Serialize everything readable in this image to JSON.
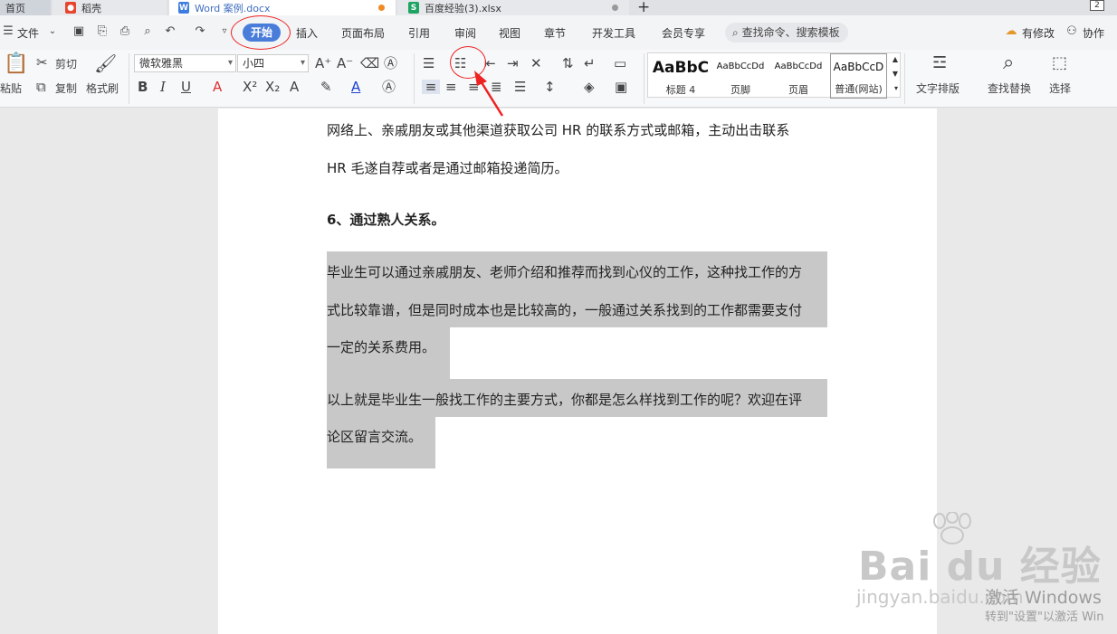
{
  "tabs": {
    "home": "首页",
    "daoke": "稻壳",
    "word": "Word 案例.docx",
    "xlsx": "百度经验(3).xlsx",
    "window_btn": "2"
  },
  "menu": {
    "file": "文件",
    "items": [
      "开始",
      "插入",
      "页面布局",
      "引用",
      "审阅",
      "视图",
      "章节",
      "开发工具",
      "会员专享"
    ],
    "search_placeholder": "查找命令、搜索模板",
    "modified": "有修改",
    "cooperate": "协作"
  },
  "ribbon": {
    "paste": "粘贴",
    "cut": "剪切",
    "copy": "复制",
    "format_painter": "格式刷",
    "font_name": "微软雅黑",
    "font_size": "小四",
    "styles": [
      {
        "preview": "AaBbC",
        "label": "标题 4"
      },
      {
        "preview": "AaBbCcDd",
        "label": "页脚"
      },
      {
        "preview": "AaBbCcDd",
        "label": "页眉"
      },
      {
        "preview": "AaBbCcD",
        "label": "普通(网站)"
      }
    ],
    "text_layout": "文字排版",
    "find_replace": "查找替换",
    "select": "选择"
  },
  "document": {
    "line1": "网络上、亲戚朋友或其他渠道获取公司 HR 的联系方式或邮箱，主动出击联系",
    "line2": "HR 毛遂自荐或者是通过邮箱投递简历。",
    "heading": "6、通过熟人关系。",
    "p1_l1": "毕业生可以通过亲戚朋友、老师介绍和推荐而找到心仪的工作，这种找工作的方",
    "p1_l2": "式比较靠谱，但是同时成本也是比较高的，一般通过关系找到的工作都需要支付",
    "p1_l3": "一定的关系费用。",
    "p2_l1": "以上就是毕业生一般找工作的主要方式，你都是怎么样找到工作的呢？欢迎在评",
    "p2_l2": "论区留言交流。"
  },
  "watermark": {
    "brand": "Bai du 经验",
    "url": "jingyan.baidu.com",
    "activate_title": "激活 Windows",
    "activate_sub": "转到\"设置\"以激活 Win"
  },
  "colors": {
    "accent": "#4a7dda",
    "annotation_red": "#e22222",
    "highlight": "#c8c8c8"
  }
}
